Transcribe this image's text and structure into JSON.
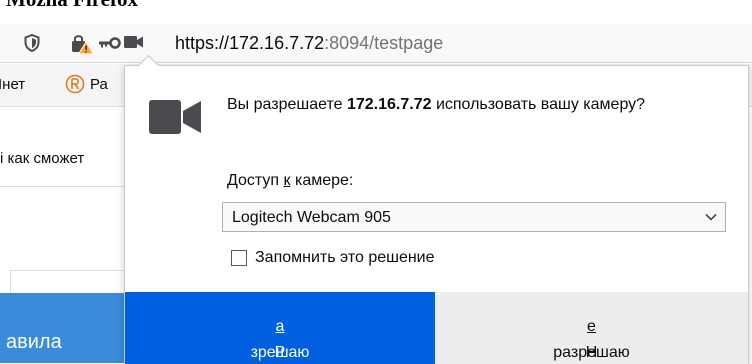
{
  "caption": "Mozila Firefox",
  "urlbar": {
    "url_host": "https://172.16.7.72",
    "url_rest": ":8094/testpage",
    "icons": [
      "shield-icon",
      "lock-warning-icon",
      "key-icon",
      "camera-icon"
    ]
  },
  "bookmarks": {
    "item1": "Інет",
    "item2": "Ра"
  },
  "page": {
    "snippet": "і как сможет",
    "button_text": "авила"
  },
  "dialog": {
    "message_before": "Вы разрешаете ",
    "message_host": "172.16.7.72",
    "message_after": " использовать вашу камеру?",
    "access_label_before": "Доступ ",
    "access_label_key": "к",
    "access_label_after": " камере:",
    "device_selected": "Logitech Webcam 905",
    "remember_label": "Запомнить это решение",
    "remember_checked": false,
    "allow_before": "Р",
    "allow_key": "а",
    "allow_after": "зрешаю",
    "deny_before": "Н",
    "deny_key": "е",
    "deny_after": " разрешаю",
    "colors": {
      "allow_bg": "#0060df",
      "deny_bg": "#ededf0",
      "camera_icon": "#4a4a4f",
      "warning": "#ffa436"
    }
  }
}
